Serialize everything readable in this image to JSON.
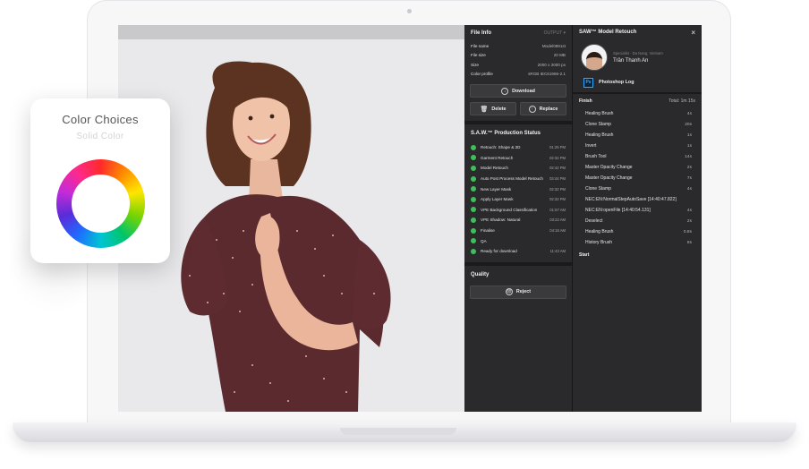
{
  "color_card": {
    "title": "Color Choices",
    "subtitle": "Solid Color"
  },
  "file_info": {
    "title": "File Info",
    "output_label": "OUTPUT",
    "rows": [
      {
        "label": "File name",
        "value": "Model0891st"
      },
      {
        "label": "File size",
        "value": "20 MB"
      },
      {
        "label": "Size",
        "value": "2000 x 3000 px"
      },
      {
        "label": "Color profile",
        "value": "sRGB IEC61966-2.1"
      }
    ],
    "download_label": "Download",
    "delete_label": "Delete",
    "replace_label": "Replace"
  },
  "production": {
    "title": "S.A.W.™ Production Status",
    "items": [
      {
        "label": "Retouch: Shape & 3D",
        "time": "01:25 PM"
      },
      {
        "label": "Garment Retouch",
        "time": "02:32 PM"
      },
      {
        "label": "Model Retouch",
        "time": "02:42 PM"
      },
      {
        "label": "Auto Post Process Model Retouch",
        "time": "03:44 PM"
      },
      {
        "label": "New Layer Mask",
        "time": "02:32 PM"
      },
      {
        "label": "Apply Layer Mask",
        "time": "02:32 PM"
      },
      {
        "label": "VPE Background Classification",
        "time": "01:57 AM"
      },
      {
        "label": "VPE Shadow: Natural",
        "time": "03:22 AM"
      },
      {
        "label": "Finalise",
        "time": "04:16 AM"
      },
      {
        "label": "QA",
        "time": ""
      },
      {
        "label": "Ready for download",
        "time": "11:43 AM"
      }
    ],
    "status_color": "#3fbf5a"
  },
  "quality": {
    "title": "Quality",
    "reject_label": "Reject"
  },
  "retouch": {
    "title": "SAW™ Model Retouch",
    "close": "×",
    "specialist_label": "Specialist",
    "location": "Da Nang, Vietnam",
    "name": "Trần Thanh An",
    "ps_badge": "Ps",
    "log_title": "Photoshop Log",
    "finish_label": "Finish",
    "total": "Total: 1m 15s",
    "history": [
      {
        "label": "Healing Brush",
        "dur": "4s"
      },
      {
        "label": "Clone Stamp",
        "dur": "20s"
      },
      {
        "label": "Healing Brush",
        "dur": "1s"
      },
      {
        "label": "Invert",
        "dur": "1s"
      },
      {
        "label": "Brush Tool",
        "dur": "14s"
      },
      {
        "label": "Master Opacity Change",
        "dur": "2s"
      },
      {
        "label": "Master Opacity Change",
        "dur": "7s"
      },
      {
        "label": "Clone Stamp",
        "dur": "4s"
      },
      {
        "label": "NEC:EN:NormalStepAutoSave [14:40:47.822]",
        "dur": ""
      },
      {
        "label": "NEC:EN:openFile [14:40:54.131]",
        "dur": "4s"
      },
      {
        "label": "Deselect",
        "dur": "2s"
      },
      {
        "label": "Healing Brush",
        "dur": "0.8s"
      },
      {
        "label": "History Brush",
        "dur": "8s"
      }
    ],
    "start_label": "Start"
  },
  "colors": {
    "accent": "#3fbf5a",
    "panel": "#2a2a2c",
    "dress": "#5a2a2e"
  }
}
